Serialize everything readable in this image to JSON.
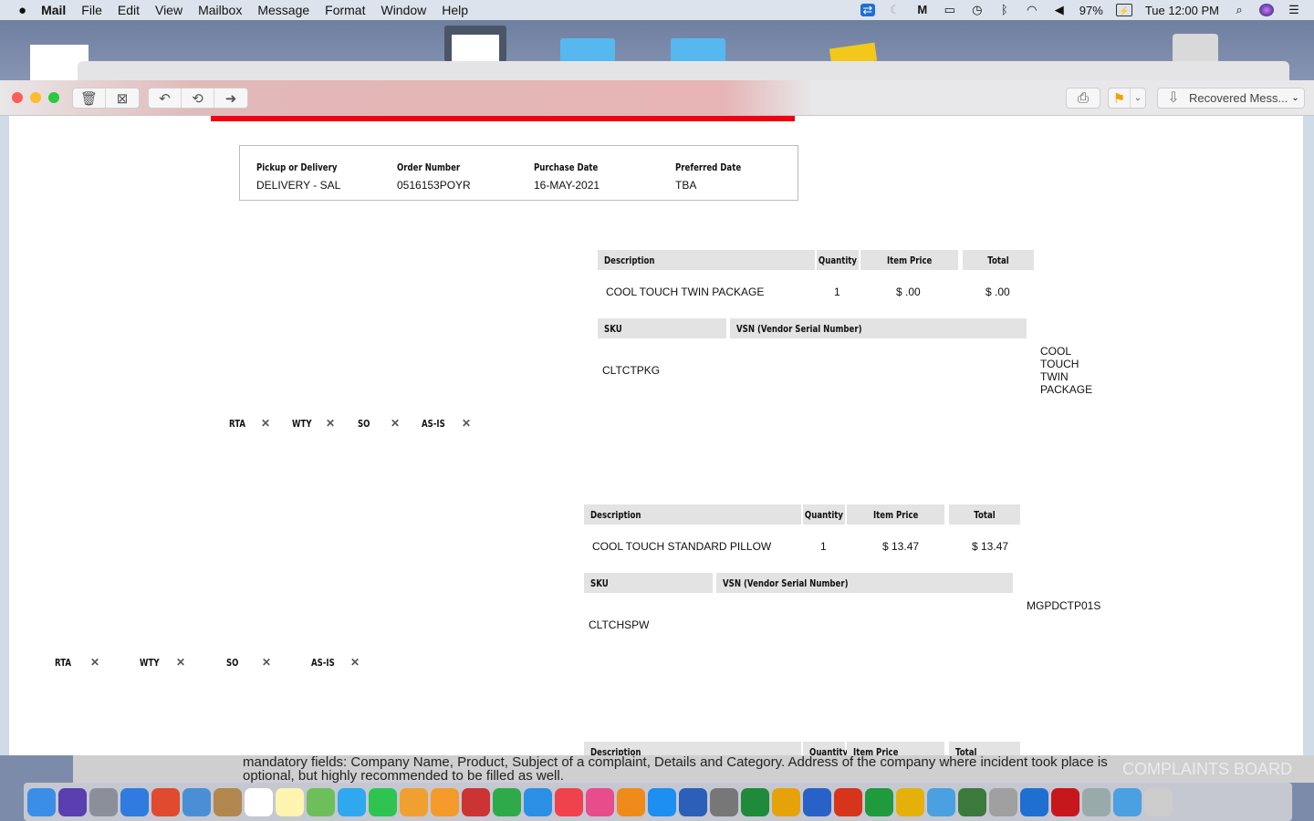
{
  "menubar": {
    "app": "Mail",
    "items": [
      "File",
      "Edit",
      "View",
      "Mailbox",
      "Message",
      "Format",
      "Window",
      "Help"
    ],
    "battery": "97%",
    "clock": "Tue 12:00 PM",
    "status_icons": [
      "teamviewer-icon",
      "moon-icon",
      "malwarebytes-icon",
      "airplay-icon",
      "time-machine-icon",
      "bluetooth-icon",
      "wifi-icon",
      "volume-icon"
    ]
  },
  "toolbar": {
    "mailbox_label": "Recovered Mess...",
    "flag_color": "#f5a000"
  },
  "order": {
    "headers": [
      "Pickup or Delivery",
      "Order Number",
      "Purchase Date",
      "Preferred Date"
    ],
    "values": [
      "DELIVERY - SAL",
      "0516153POYR",
      "16-MAY-2021",
      "TBA"
    ]
  },
  "table_headers": {
    "description": "Description",
    "quantity": "Quantity",
    "item_price": "Item Price",
    "total": "Total",
    "sku": "SKU",
    "vsn": "VSN (Vendor Serial Number)"
  },
  "items": [
    {
      "description": "COOL TOUCH TWIN PACKAGE",
      "quantity": "1",
      "item_price": "$ .00",
      "total": "$ .00",
      "sku": "CLTCTPKG",
      "vendor": "COOL TOUCH TWIN PACKAGE"
    },
    {
      "description": "COOL TOUCH STANDARD PILLOW",
      "quantity": "1",
      "item_price": "$ 13.47",
      "total": "$ 13.47",
      "sku": "CLTCHSPW",
      "vendor": "MGPDCTP01S"
    }
  ],
  "flags": [
    "RTA",
    "WTY",
    "SO",
    "AS-IS"
  ],
  "flag_mark": "✕",
  "background_page": {
    "line1": "mandatory fields: Company Name, Product, Subject of a complaint, Details and Category. Address of the company where incident took place is",
    "line2": "optional, but highly recommended to be filled as well.",
    "watermark": "COMPLAINTS BOARD"
  },
  "dock": [
    "finder",
    "siri",
    "launchpad",
    "safari",
    "chrome",
    "preview",
    "notefile",
    "calendar",
    "notes",
    "maps",
    "messages",
    "facetime",
    "photos",
    "pages",
    "photo-booth",
    "numbers",
    "keynote",
    "news",
    "itunes",
    "books",
    "app-store",
    "word",
    "system-preferences",
    "excel",
    "outlook",
    "word",
    "powerpoint",
    "excel",
    "outlook",
    "contacts",
    "vpn",
    "utility",
    "teamviewer",
    "acrobat",
    "finder-2",
    "downloads",
    "trash"
  ]
}
